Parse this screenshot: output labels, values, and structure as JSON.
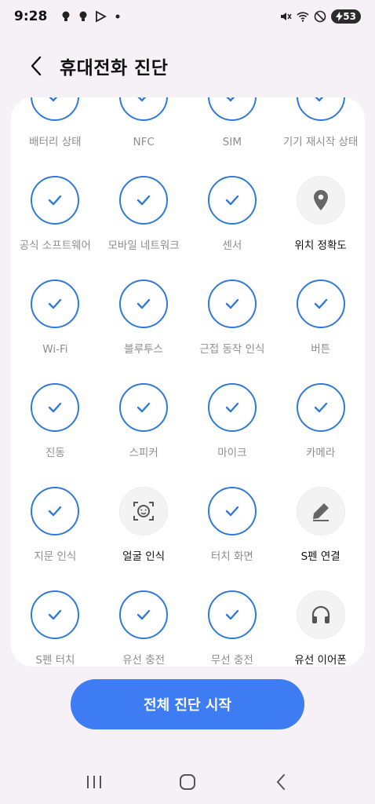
{
  "status_bar": {
    "time": "9:28",
    "battery": "53"
  },
  "header": {
    "title": "휴대전화 진단"
  },
  "colors": {
    "accent": "#2f7ad9",
    "button": "#3d7cf2",
    "background": "#f6f1f6"
  },
  "tests": [
    {
      "label": "배터리 상태",
      "done": true,
      "icon": "check-icon"
    },
    {
      "label": "NFC",
      "done": true,
      "icon": "check-icon"
    },
    {
      "label": "SIM",
      "done": true,
      "icon": "check-icon"
    },
    {
      "label": "기기 재시작 상태",
      "done": true,
      "icon": "check-icon"
    },
    {
      "label": "공식 소프트웨어",
      "done": true,
      "icon": "check-icon"
    },
    {
      "label": "모바일 네트워크",
      "done": true,
      "icon": "check-icon"
    },
    {
      "label": "센서",
      "done": true,
      "icon": "check-icon"
    },
    {
      "label": "위치 정확도",
      "done": false,
      "icon": "location-pin-icon"
    },
    {
      "label": "Wi-Fi",
      "done": true,
      "icon": "check-icon"
    },
    {
      "label": "블루투스",
      "done": true,
      "icon": "check-icon"
    },
    {
      "label": "근접 동작 인식",
      "done": true,
      "icon": "check-icon"
    },
    {
      "label": "버튼",
      "done": true,
      "icon": "check-icon"
    },
    {
      "label": "진동",
      "done": true,
      "icon": "check-icon"
    },
    {
      "label": "스피커",
      "done": true,
      "icon": "check-icon"
    },
    {
      "label": "마이크",
      "done": true,
      "icon": "check-icon"
    },
    {
      "label": "카메라",
      "done": true,
      "icon": "check-icon"
    },
    {
      "label": "지문 인식",
      "done": true,
      "icon": "check-icon"
    },
    {
      "label": "얼굴 인식",
      "done": false,
      "icon": "face-scan-icon"
    },
    {
      "label": "터치 화면",
      "done": true,
      "icon": "check-icon"
    },
    {
      "label": "S펜 연결",
      "done": false,
      "icon": "pen-icon"
    },
    {
      "label": "S펜 터치",
      "done": true,
      "icon": "check-icon"
    },
    {
      "label": "유선 충전",
      "done": true,
      "icon": "check-icon"
    },
    {
      "label": "무선 충전",
      "done": true,
      "icon": "check-icon"
    },
    {
      "label": "유선 이어폰",
      "done": false,
      "icon": "headphones-icon"
    }
  ],
  "start_button": {
    "label": "전체 진단 시작"
  }
}
